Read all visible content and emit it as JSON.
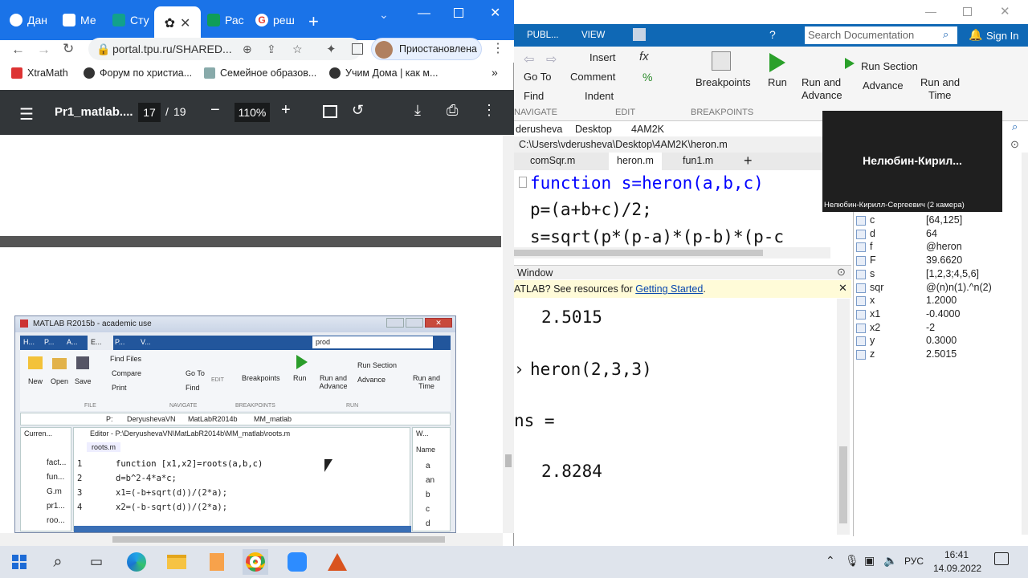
{
  "chrome": {
    "tabs": [
      {
        "label": "Дан",
        "icon": "zoom-icon",
        "color": "#2d8cff"
      },
      {
        "label": "Ме",
        "icon": "teams-chat-icon",
        "color": "#4b53bc"
      },
      {
        "label": "Сту",
        "icon": "site-icon",
        "color": "#12a18b"
      },
      {
        "label": "",
        "icon": "openai-icon",
        "color": "#222222",
        "active": true
      },
      {
        "label": "Рас",
        "icon": "sheets-icon",
        "color": "#0f9d58"
      },
      {
        "label": "реш",
        "icon": "google-icon",
        "color": "#ea4335"
      }
    ],
    "url": "portal.tpu.ru/SHARED...",
    "profile_label": "Приостановлена",
    "bookmarks": [
      {
        "label": "XtraMath"
      },
      {
        "label": "Форум по христиа..."
      },
      {
        "label": "Семейное образов..."
      },
      {
        "label": "Учим Дома | как м..."
      }
    ]
  },
  "pdf": {
    "title": "Pr1_matlab....",
    "page_current": "17",
    "page_sep": "/",
    "page_total": "19",
    "zoom": "110%"
  },
  "embedded_matlab": {
    "title": "MATLAB R2015b - academic use",
    "search": "prod",
    "tabs": [
      "H...",
      "P...",
      "A...",
      "E...",
      "P...",
      "V..."
    ],
    "buttons": {
      "new": "New",
      "open": "Open",
      "save": "Save",
      "find_files": "Find Files",
      "compare": "Compare",
      "print": "Print",
      "goto": "Go To",
      "find": "Find",
      "breakpoints": "Breakpoints",
      "run": "Run",
      "run_advance": "Run and Advance",
      "run_section": "Run Section",
      "advance": "Advance",
      "run_time": "Run and Time"
    },
    "section_labels": [
      "FILE",
      "NAVIGATE",
      "EDIT",
      "BREAKPOINTS",
      "RUN"
    ],
    "path": [
      "P:",
      "DeryushevaVN",
      "MatLabR2014b",
      "MM_matlab"
    ],
    "current_folder_label": "Curren...",
    "files": [
      "fact...",
      "fun...",
      "G.m",
      "pr1...",
      "roo..."
    ],
    "editor_title": "Editor - P:\\DeryushevaVN\\MatLabR2014b\\MM_matlab\\roots.m",
    "editor_tab": "roots.m",
    "code": [
      {
        "n": "1",
        "text": "function [x1,x2]=roots(a,b,c)"
      },
      {
        "n": "2",
        "text": "d=b^2-4*a*c;"
      },
      {
        "n": "3",
        "text": "x1=(-b+sqrt(d))/(2*a);"
      },
      {
        "n": "4",
        "text": "x2=(-b-sqrt(d))/(2*a);"
      }
    ],
    "workspace_label": "W...",
    "ws_header": "Name",
    "ws_items": [
      "a",
      "an",
      "b",
      "c",
      "d"
    ]
  },
  "matlab": {
    "top_tabs": [
      "PUBL...",
      "VIEW"
    ],
    "search_placeholder": "Search Documentation",
    "sign_in": "Sign In",
    "toolstrip": {
      "insert": "Insert",
      "comment": "Comment",
      "indent": "Indent",
      "goto": "Go To",
      "find": "Find",
      "breakpoints": "Breakpoints",
      "run": "Run",
      "run_advance_1": "Run and",
      "run_advance_2": "Advance",
      "run_section": "Run Section",
      "advance": "Advance",
      "run_time_1": "Run and",
      "run_time_2": "Time",
      "sec_navigate": "NAVIGATE",
      "sec_edit": "EDIT",
      "sec_breakpoints": "BREAKPOINTS",
      "sec_run": "RUN"
    },
    "breadcrumb": [
      "derusheva",
      "Desktop",
      "4AM2K"
    ],
    "file_path": "C:\\Users\\vderusheva\\Desktop\\4AM2K\\heron.m",
    "editor_tabs": [
      "comSqr.m",
      "heron.m",
      "fun1.m"
    ],
    "editor_lines": [
      "function s=heron(a,b,c)",
      "p=(a+b+c)/2;",
      "s=sqrt(p*(p-a)*(p-b)*(p-c"
    ],
    "cmd_title": "Window",
    "cmd_notice_prefix": "ATLAB? See resources for ",
    "cmd_notice_link": "Getting Started",
    "cmd_notice_suffix": ".",
    "cmd_lines": [
      "2.5015",
      "heron(2,3,3)",
      "ns =",
      "2.8284"
    ],
    "workspace": [
      {
        "name": "c",
        "value": "[64,125]"
      },
      {
        "name": "d",
        "value": "64"
      },
      {
        "name": "f",
        "value": "@heron"
      },
      {
        "name": "F",
        "value": "39.6620"
      },
      {
        "name": "s",
        "value": "[1,2,3;4,5,6]"
      },
      {
        "name": "sqr",
        "value": "@(n)n(1).^n(2)"
      },
      {
        "name": "x",
        "value": "1.2000"
      },
      {
        "name": "x1",
        "value": "-0.4000"
      },
      {
        "name": "x2",
        "value": "-2"
      },
      {
        "name": "y",
        "value": "0.3000"
      },
      {
        "name": "z",
        "value": "2.5015"
      }
    ]
  },
  "video": {
    "name": "Нелюбин-Кирил...",
    "caption": "Нелюбин-Кирилл-Сергеевич (2 камера)"
  },
  "taskbar": {
    "lang": "РУС",
    "time": "16:41",
    "date": "14.09.2022"
  }
}
